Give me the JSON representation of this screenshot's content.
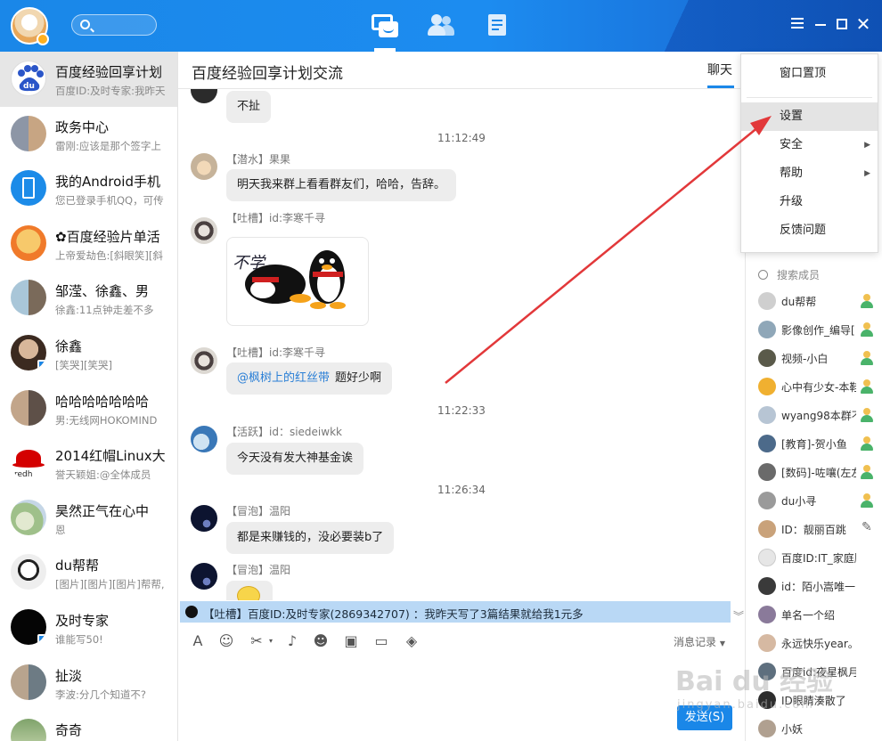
{
  "conversations": [
    {
      "name": "百度经验回享计划",
      "preview": "百度ID:及时专家:我昨天"
    },
    {
      "name": "政务中心",
      "preview": "雷刚:应该是那个签字上"
    },
    {
      "name": "我的Android手机",
      "preview": "您已登录手机QQ，可传"
    },
    {
      "name": "✿百度经验片单活",
      "preview": "上帝爱劫色:[斜眼笑][斜"
    },
    {
      "name": "邹滢、徐鑫、男",
      "preview": "徐鑫:11点钟走差不多"
    },
    {
      "name": "徐鑫",
      "preview": "[笑哭][笑哭]"
    },
    {
      "name": "哈哈哈哈哈哈哈",
      "preview": "男:无线网HOKOMIND"
    },
    {
      "name": "2014红帽Linux大",
      "preview": "誉天颖姐:@全体成员"
    },
    {
      "name": "昊然正气在心中",
      "preview": "恩"
    },
    {
      "name": "du帮帮",
      "preview": "[图片][图片][图片]帮帮,"
    },
    {
      "name": "及时专家",
      "preview": "谁能写50!"
    },
    {
      "name": "扯淡",
      "preview": "李波:分几个知道不?"
    },
    {
      "name": "奇奇",
      "preview": ""
    }
  ],
  "chat": {
    "title": "百度经验回享计划交流",
    "tab": "聊天",
    "messages": {
      "m0_text": "不扯",
      "t1": "11:12:49",
      "m1_name": "【潜水】果果",
      "m1_text": "明天我来群上看看群友们，哈哈，告辞。",
      "m2_name": "【吐槽】id:李寒千寻",
      "m3_name": "【吐槽】id:李寒千寻",
      "m3_mention": "@枫树上的红丝带",
      "m3_text": "题好少啊",
      "t2": "11:22:33",
      "m4_name": "【活跃】id：siedeiwkk",
      "m4_text": "今天没有发大神基金诶",
      "t3": "11:26:34",
      "m5_name": "【冒泡】温阳",
      "m5_text": "都是来赚钱的，没必要装b了",
      "m6_name": "【冒泡】温阳"
    },
    "notice": "【吐槽】百度ID:及时专家(2869342707) ：我昨天写了3篇结果就给我1元多",
    "history_label": "消息记录",
    "send_label": "发送(S)"
  },
  "menu": {
    "items": [
      "窗口置顶",
      "设置",
      "安全",
      "帮助",
      "升级",
      "反馈问题"
    ],
    "hovered": "设置"
  },
  "members": {
    "search_placeholder": "搜索成员",
    "list": [
      "du帮帮",
      "影像创作_编导[",
      "视频-小白",
      "心中有少女-本鞋",
      "wyang98本群不",
      "[教育]-贺小鱼",
      "[数码]-咗嚷(左左",
      "du小寻",
      "ID：靓丽百跳",
      "百度ID:IT_家庭顾问",
      "id：陌小嵩唯一",
      "单名一个绍",
      "永远快乐year。",
      "百度id:夜星枫月",
      "ID眼睛湊散了",
      "小妖"
    ]
  },
  "watermark": {
    "brand": "Bai du 经验",
    "sub": "jingyan.baidu.com"
  },
  "colors": {
    "accent": "#1a87e8",
    "notice_bg": "#b9d8f5",
    "arrow": "#e2383a"
  }
}
